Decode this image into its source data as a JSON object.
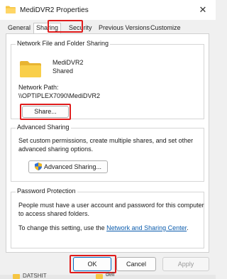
{
  "window": {
    "title": "MediDVR2 Properties",
    "close_glyph": "✕"
  },
  "tabs": [
    {
      "label": "General"
    },
    {
      "label": "Sharing"
    },
    {
      "label": "Security"
    },
    {
      "label": "Previous Versions"
    },
    {
      "label": "Customize"
    }
  ],
  "network_sharing": {
    "group_title": "Network File and Folder Sharing",
    "share_name": "MediDVR2",
    "share_state": "Shared",
    "network_path_label": "Network Path:",
    "network_path_value": "\\\\OPTIPLEX7090\\MediDVR2",
    "share_button": "Share..."
  },
  "advanced_sharing": {
    "group_title": "Advanced Sharing",
    "description": "Set custom permissions, create multiple shares, and set other advanced sharing options.",
    "button": "Advanced Sharing..."
  },
  "password_protection": {
    "group_title": "Password Protection",
    "description": "People must have a user account and password for this computer to access shared folders.",
    "change_prefix": "To change this setting, use the ",
    "link": "Network and Sharing Center",
    "change_suffix": "."
  },
  "footer": {
    "ok": "OK",
    "cancel": "Cancel",
    "apply": "Apply"
  },
  "background": {
    "item_left": "DATSHIT",
    "item_right": "dell"
  },
  "colors": {
    "highlight": "#e01b1b",
    "folder": "#f5c543",
    "link": "#0b5cad",
    "accent": "#0067c0"
  },
  "icons": {
    "title": "folder-icon",
    "share": "folder-icon",
    "advanced": "shield-icon",
    "close": "close-icon"
  }
}
